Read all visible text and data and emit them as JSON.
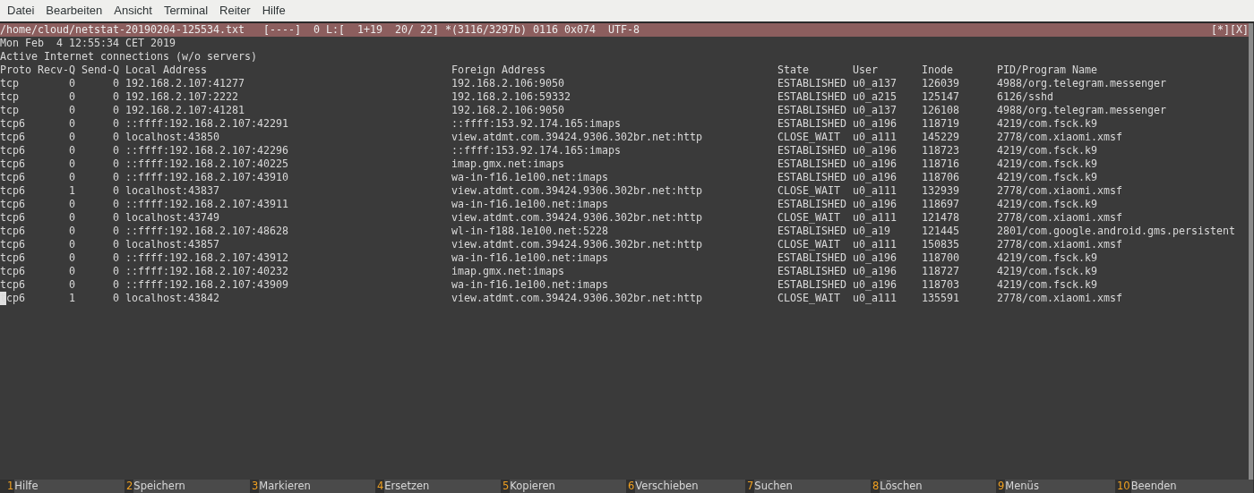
{
  "menu": [
    "Datei",
    "Bearbeiten",
    "Ansicht",
    "Terminal",
    "Reiter",
    "Hilfe"
  ],
  "editor": {
    "status_line": "/home/cloud/netstat-20190204-125534.txt   [----]  0 L:[  1+19  20/ 22] *(3116/3297b) 0116 0x074  UTF-8",
    "window_buttons": "[*][X]",
    "lines": [
      "Mon Feb  4 12:55:34 CET 2019",
      "Active Internet connections (w/o servers)"
    ],
    "table": {
      "columns": [
        "Proto",
        "Recv-Q",
        "Send-Q",
        "Local Address",
        "Foreign Address",
        "State",
        "User",
        "Inode",
        "PID/Program Name"
      ],
      "rows": [
        {
          "cells": [
            "tcp",
            "0",
            "0",
            "192.168.2.107:41277",
            "192.168.2.106:9050",
            "ESTABLISHED",
            "u0_a137",
            "126039",
            "4988/org.telegram.messenger"
          ],
          "cursor": false
        },
        {
          "cells": [
            "tcp",
            "0",
            "0",
            "192.168.2.107:2222",
            "192.168.2.106:59332",
            "ESTABLISHED",
            "u0_a215",
            "125147",
            "6126/sshd"
          ],
          "cursor": false
        },
        {
          "cells": [
            "tcp",
            "0",
            "0",
            "192.168.2.107:41281",
            "192.168.2.106:9050",
            "ESTABLISHED",
            "u0_a137",
            "126108",
            "4988/org.telegram.messenger"
          ],
          "cursor": false
        },
        {
          "cells": [
            "tcp6",
            "0",
            "0",
            "::ffff:192.168.2.107:42291",
            "::ffff:153.92.174.165:imaps",
            "ESTABLISHED",
            "u0_a196",
            "118719",
            "4219/com.fsck.k9"
          ],
          "cursor": false
        },
        {
          "cells": [
            "tcp6",
            "0",
            "0",
            "localhost:43850",
            "view.atdmt.com.39424.9306.302br.net:http",
            "CLOSE_WAIT",
            "u0_a111",
            "145229",
            "2778/com.xiaomi.xmsf"
          ],
          "cursor": false
        },
        {
          "cells": [
            "tcp6",
            "0",
            "0",
            "::ffff:192.168.2.107:42296",
            "::ffff:153.92.174.165:imaps",
            "ESTABLISHED",
            "u0_a196",
            "118723",
            "4219/com.fsck.k9"
          ],
          "cursor": false
        },
        {
          "cells": [
            "tcp6",
            "0",
            "0",
            "::ffff:192.168.2.107:40225",
            "imap.gmx.net:imaps",
            "ESTABLISHED",
            "u0_a196",
            "118716",
            "4219/com.fsck.k9"
          ],
          "cursor": false
        },
        {
          "cells": [
            "tcp6",
            "0",
            "0",
            "::ffff:192.168.2.107:43910",
            "wa-in-f16.1e100.net:imaps",
            "ESTABLISHED",
            "u0_a196",
            "118706",
            "4219/com.fsck.k9"
          ],
          "cursor": false
        },
        {
          "cells": [
            "tcp6",
            "1",
            "0",
            "localhost:43837",
            "view.atdmt.com.39424.9306.302br.net:http",
            "CLOSE_WAIT",
            "u0_a111",
            "132939",
            "2778/com.xiaomi.xmsf"
          ],
          "cursor": false
        },
        {
          "cells": [
            "tcp6",
            "0",
            "0",
            "::ffff:192.168.2.107:43911",
            "wa-in-f16.1e100.net:imaps",
            "ESTABLISHED",
            "u0_a196",
            "118697",
            "4219/com.fsck.k9"
          ],
          "cursor": false
        },
        {
          "cells": [
            "tcp6",
            "0",
            "0",
            "localhost:43749",
            "view.atdmt.com.39424.9306.302br.net:http",
            "CLOSE_WAIT",
            "u0_a111",
            "121478",
            "2778/com.xiaomi.xmsf"
          ],
          "cursor": false
        },
        {
          "cells": [
            "tcp6",
            "0",
            "0",
            "::ffff:192.168.2.107:48628",
            "wl-in-f188.1e100.net:5228",
            "ESTABLISHED",
            "u0_a19",
            "121445",
            "2801/com.google.android.gms.persistent"
          ],
          "cursor": false
        },
        {
          "cells": [
            "tcp6",
            "0",
            "0",
            "localhost:43857",
            "view.atdmt.com.39424.9306.302br.net:http",
            "CLOSE_WAIT",
            "u0_a111",
            "150835",
            "2778/com.xiaomi.xmsf"
          ],
          "cursor": false
        },
        {
          "cells": [
            "tcp6",
            "0",
            "0",
            "::ffff:192.168.2.107:43912",
            "wa-in-f16.1e100.net:imaps",
            "ESTABLISHED",
            "u0_a196",
            "118700",
            "4219/com.fsck.k9"
          ],
          "cursor": false
        },
        {
          "cells": [
            "tcp6",
            "0",
            "0",
            "::ffff:192.168.2.107:40232",
            "imap.gmx.net:imaps",
            "ESTABLISHED",
            "u0_a196",
            "118727",
            "4219/com.fsck.k9"
          ],
          "cursor": false
        },
        {
          "cells": [
            "tcp6",
            "0",
            "0",
            "::ffff:192.168.2.107:43909",
            "wa-in-f16.1e100.net:imaps",
            "ESTABLISHED",
            "u0_a196",
            "118703",
            "4219/com.fsck.k9"
          ],
          "cursor": false
        },
        {
          "cells": [
            "tcp6",
            "1",
            "0",
            "localhost:43842",
            "view.atdmt.com.39424.9306.302br.net:http",
            "CLOSE_WAIT",
            "u0_a111",
            "135591",
            "2778/com.xiaomi.xmsf"
          ],
          "cursor": true
        }
      ]
    }
  },
  "function_keys": [
    {
      "key": "1",
      "label": "Hilfe"
    },
    {
      "key": "2",
      "label": "Speichern"
    },
    {
      "key": "3",
      "label": "Markieren"
    },
    {
      "key": "4",
      "label": "Ersetzen"
    },
    {
      "key": "5",
      "label": "Kopieren"
    },
    {
      "key": "6",
      "label": "Verschieben"
    },
    {
      "key": "7",
      "label": "Suchen"
    },
    {
      "key": "8",
      "label": "Löschen"
    },
    {
      "key": "9",
      "label": "Menüs"
    },
    {
      "key": "10",
      "label": "Beenden"
    }
  ]
}
